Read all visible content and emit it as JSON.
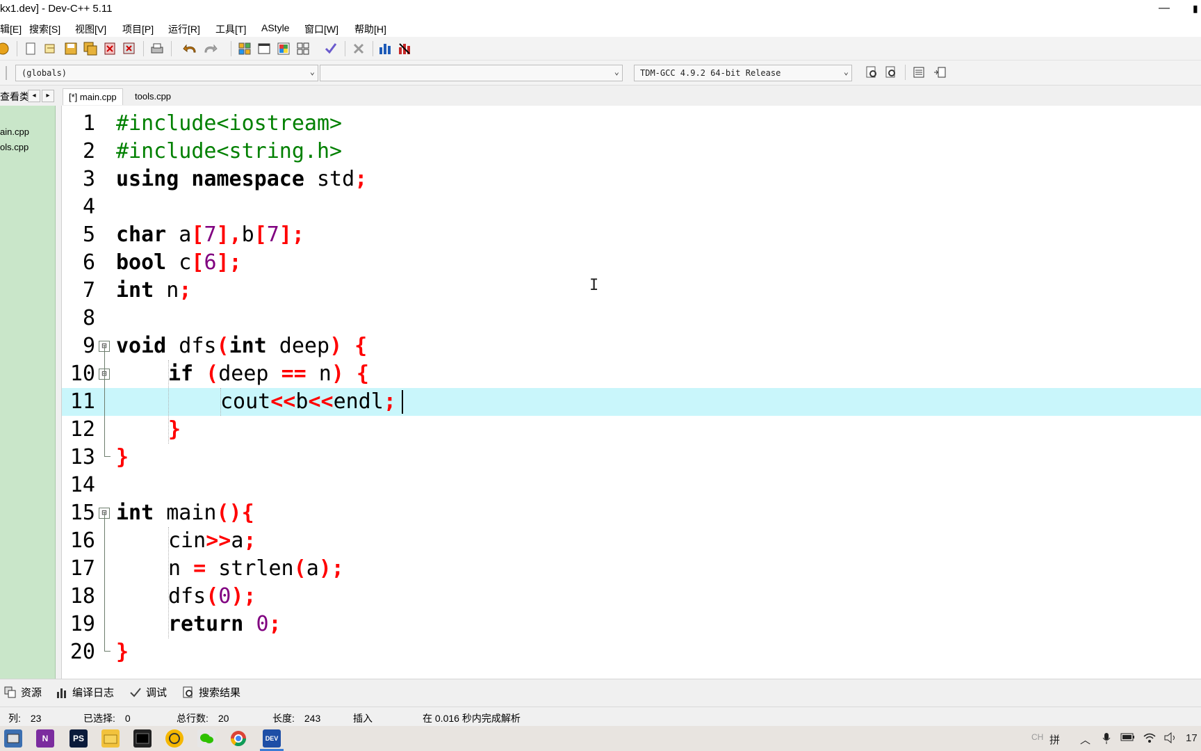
{
  "window": {
    "title": "kx1.dev] - Dev-C++ 5.11",
    "minimize": "—",
    "maximize": "▮"
  },
  "menu": [
    "辑[E]",
    "搜索[S]",
    "视图[V]",
    "项目[P]",
    "运行[R]",
    "工具[T]",
    "AStyle",
    "窗口[W]",
    "帮助[H]"
  ],
  "combos": {
    "scope": "(globals)",
    "symbol": "",
    "compiler": "TDM-GCC 4.9.2 64-bit Release"
  },
  "panel_tab_label": "查看类",
  "tabs": [
    "[*] main.cpp",
    "tools.cpp"
  ],
  "project_files": [
    "ain.cpp",
    "ols.cpp"
  ],
  "code_lines": [
    "1",
    "2",
    "3",
    "4",
    "5",
    "6",
    "7",
    "8",
    "9",
    "10",
    "11",
    "12",
    "13",
    "14",
    "15",
    "16",
    "17",
    "18",
    "19",
    "20"
  ],
  "code": {
    "l1": "#include<iostream>",
    "l2": "#include<string.h>",
    "l3_a": "using namespace",
    "l3_b": " std",
    "l3_c": ";",
    "l5_a": "char",
    "l5_b": " a",
    "l5_c": "[",
    "l5_d": "7",
    "l5_e": "],",
    "l5_f": "b",
    "l5_g": "[",
    "l5_h": "7",
    "l5_i": "];",
    "l6_a": "bool",
    "l6_b": " c",
    "l6_c": "[",
    "l6_d": "6",
    "l6_e": "];",
    "l7_a": "int",
    "l7_b": " n",
    "l7_c": ";",
    "l9_a": "void",
    "l9_b": " dfs",
    "l9_c": "(",
    "l9_d": "int",
    "l9_e": " deep",
    "l9_f": ") {",
    "l10_a": "if",
    "l10_b": " (",
    "l10_c": "deep ",
    "l10_d": "==",
    "l10_e": " n",
    "l10_f": ") {",
    "l11_a": "cout",
    "l11_b": "<<",
    "l11_c": "b",
    "l11_d": "<<",
    "l11_e": "endl",
    "l11_f": ";",
    "l12": "}",
    "l13": "}",
    "l15_a": "int",
    "l15_b": " main",
    "l15_c": "(){",
    "l16_a": "cin",
    "l16_b": ">>",
    "l16_c": "a",
    "l16_d": ";",
    "l17_a": "n ",
    "l17_b": "=",
    "l17_c": " strlen",
    "l17_d": "(",
    "l17_e": "a",
    "l17_f": ");",
    "l18_a": "dfs",
    "l18_b": "(",
    "l18_c": "0",
    "l18_d": ");",
    "l19_a": "return",
    "l19_b": " ",
    "l19_c": "0",
    "l19_d": ";",
    "l20": "}"
  },
  "fold_markers": [
    "⊟",
    "⊟",
    "⊟"
  ],
  "bottom_tabs": [
    "资源",
    "编译日志",
    "调试",
    "搜索结果"
  ],
  "status": {
    "col_label": "列:",
    "col_value": "23",
    "sel_label": "已选择:",
    "sel_value": "0",
    "lines_label": "总行数:",
    "lines_value": "20",
    "len_label": "长度:",
    "len_value": "243",
    "mode": "插入",
    "parse": "在 0.016 秒内完成解析"
  },
  "taskbar": {
    "apps": [
      "N",
      "PS",
      "DEV"
    ],
    "tray_ime_1": "CH",
    "tray_ime_2": "拼",
    "clock": "17"
  },
  "colors": {
    "keyword": "#000000",
    "preprocessor": "#008000",
    "symbol": "#ff0000",
    "number": "#800080",
    "current_line": "#c9f6fb",
    "left_panel": "#c9e6c9"
  }
}
